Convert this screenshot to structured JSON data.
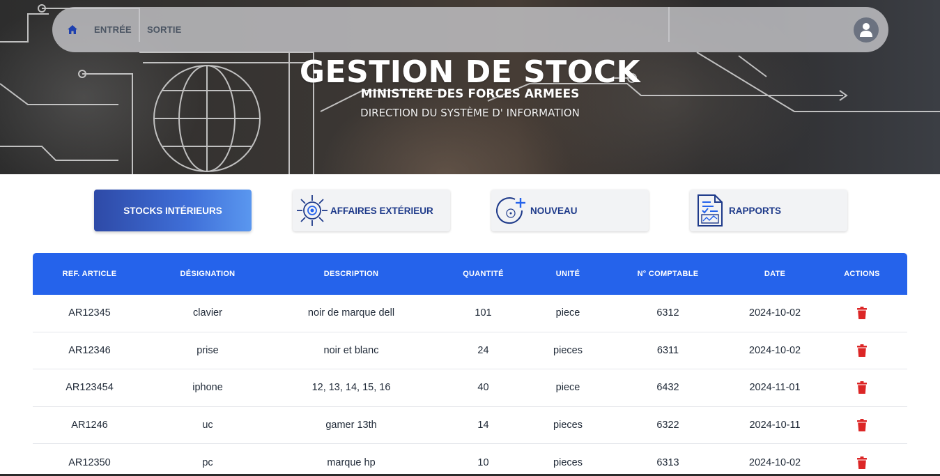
{
  "colors": {
    "primary": "#2563eb",
    "button_navy": "#1e3a8a",
    "delete_red": "#dc2626",
    "nav_text": "#4b5563"
  },
  "nav": {
    "home_icon": "home-icon",
    "links": [
      "ENTRÉE",
      "SORTIE"
    ],
    "avatar_icon": "user-icon"
  },
  "hero": {
    "title": "GESTION DE STOCK",
    "subtitle": "MINISTERE DES FORCES ARMEES",
    "subtitle2": "DIRECTION DU SYSTÈME D' INFORMATION"
  },
  "actions": [
    {
      "label": "STOCKS INTÉRIEURS",
      "icon": null,
      "active": true
    },
    {
      "label": "AFFAIRES EXTÉRIEUR",
      "icon": "compass-target-icon",
      "active": false
    },
    {
      "label": "NOUVEAU",
      "icon": "add-circle-icon",
      "active": false
    },
    {
      "label": "RAPPORTS",
      "icon": "report-document-icon",
      "active": false
    }
  ],
  "table": {
    "headers": [
      "REF. ARTICLE",
      "DÉSIGNATION",
      "DESCRIPTION",
      "QUANTITÉ",
      "UNITÉ",
      "N° COMPTABLE",
      "DATE",
      "ACTIONS"
    ],
    "rows": [
      [
        "AR12345",
        "clavier",
        "noir de marque dell",
        "101",
        "piece",
        "6312",
        "2024-10-02"
      ],
      [
        "AR12346",
        "prise",
        "noir et blanc",
        "24",
        "pieces",
        "6311",
        "2024-10-02"
      ],
      [
        "AR123454",
        "iphone",
        "12, 13, 14, 15, 16",
        "40",
        "piece",
        "6432",
        "2024-11-01"
      ],
      [
        "AR1246",
        "uc",
        "gamer 13th",
        "14",
        "pieces",
        "6322",
        "2024-10-11"
      ],
      [
        "AR12350",
        "pc",
        "marque hp",
        "10",
        "pieces",
        "6313",
        "2024-10-02"
      ]
    ],
    "row_action_icon": "trash-icon"
  }
}
